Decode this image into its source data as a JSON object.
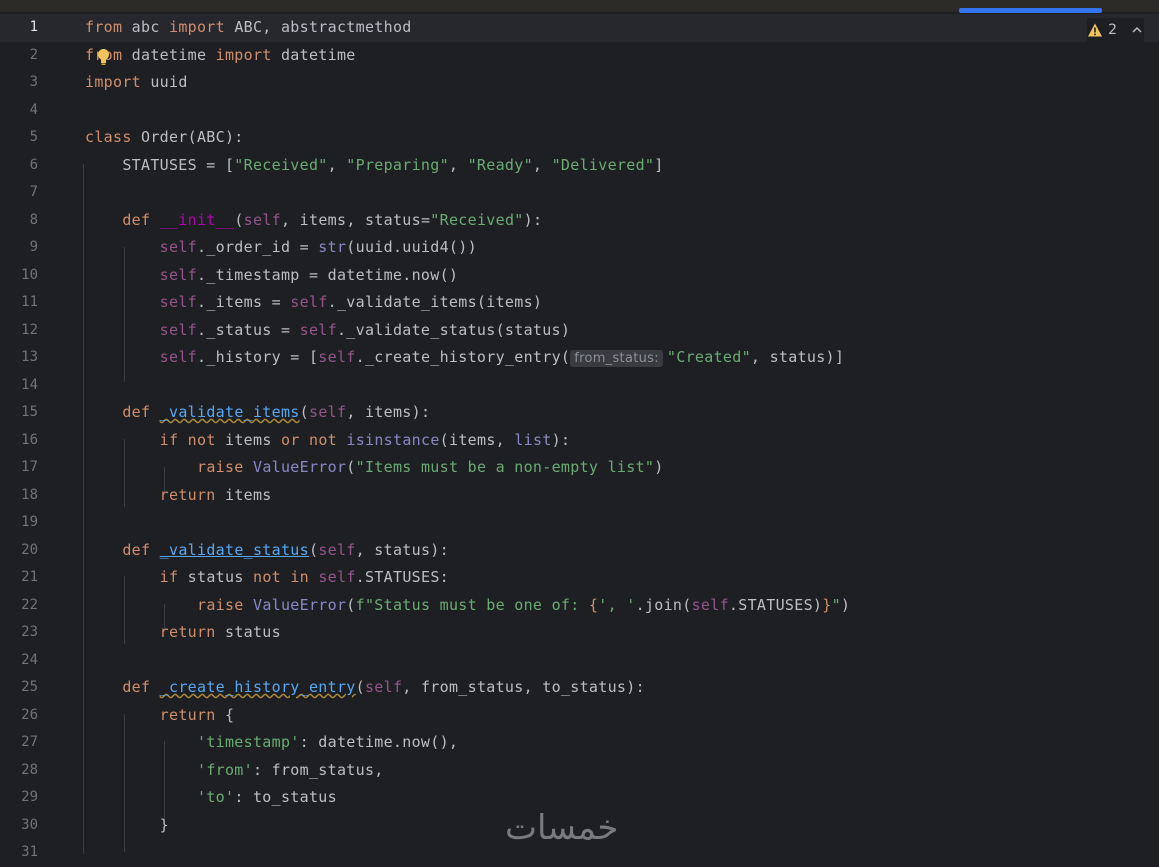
{
  "editor": {
    "warning_count": "2",
    "line_numbers": [
      "1",
      "2",
      "3",
      "4",
      "5",
      "6",
      "7",
      "8",
      "9",
      "10",
      "11",
      "12",
      "13",
      "14",
      "15",
      "16",
      "17",
      "18",
      "19",
      "20",
      "21",
      "22",
      "23",
      "24",
      "25",
      "26",
      "27",
      "28",
      "29",
      "30",
      "31"
    ],
    "inlay_hint": "from_status:",
    "watermark_text": "خمسات"
  },
  "code": {
    "l1": [
      "from",
      " abc ",
      "import",
      " ABC, abstractmethod"
    ],
    "l2": [
      "from",
      " datetime ",
      "import",
      " datetime"
    ],
    "l3": [
      "import",
      " uuid"
    ],
    "l5": [
      "class",
      " Order(ABC):"
    ],
    "l6": [
      "    STATUSES = [",
      "\"Received\"",
      ", ",
      "\"Preparing\"",
      ", ",
      "\"Ready\"",
      ", ",
      "\"Delivered\"",
      "]"
    ],
    "l8": [
      "    ",
      "def",
      " ",
      "__init__",
      "(",
      "self",
      ", items, status=",
      "\"Received\"",
      "):"
    ],
    "l9": [
      "        ",
      "self",
      "._order_id = ",
      "str",
      "(uuid.uuid4())"
    ],
    "l10": [
      "        ",
      "self",
      "._timestamp = datetime.now()"
    ],
    "l11": [
      "        ",
      "self",
      "._items = ",
      "self",
      "._validate_items(items)"
    ],
    "l12": [
      "        ",
      "self",
      "._status = ",
      "self",
      "._validate_status(status)"
    ],
    "l13": [
      "        ",
      "self",
      "._history = [",
      "self",
      "._create_history_entry(",
      "\"Created\"",
      ", status)]"
    ],
    "l15": [
      "    ",
      "def",
      " ",
      "_validate_items",
      "(",
      "self",
      ", items):"
    ],
    "l16": [
      "        ",
      "if",
      " ",
      "not",
      " items ",
      "or",
      " ",
      "not",
      " ",
      "isinstance",
      "(items, ",
      "list",
      "):"
    ],
    "l17": [
      "            ",
      "raise",
      " ",
      "ValueError",
      "(",
      "\"Items must be a non-empty list\"",
      ")"
    ],
    "l18": [
      "        ",
      "return",
      " items"
    ],
    "l20": [
      "    ",
      "def",
      " ",
      "_validate_status",
      "(",
      "self",
      ", status):"
    ],
    "l21": [
      "        ",
      "if",
      " status ",
      "not",
      " ",
      "in",
      " ",
      "self",
      ".STATUSES:"
    ],
    "l22": [
      "            ",
      "raise",
      " ",
      "ValueError",
      "(",
      "f\"Status must be one of: ",
      "{",
      "', '",
      ".join(",
      "self",
      ".STATUSES)",
      "}",
      "\"",
      ")"
    ],
    "l23": [
      "        ",
      "return",
      " status"
    ],
    "l25": [
      "    ",
      "def",
      " ",
      "_create_history_entry",
      "(",
      "self",
      ", from_status, to_status):"
    ],
    "l26": [
      "        ",
      "return",
      " {"
    ],
    "l27": [
      "            ",
      "'timestamp'",
      ": datetime.now(),"
    ],
    "l28": [
      "            ",
      "'from'",
      ": from_status,"
    ],
    "l29": [
      "            ",
      "'to'",
      ": to_status"
    ],
    "l30": [
      "        }"
    ]
  },
  "colors": {
    "background": "#1e1f22",
    "keyword": "#cf8e6d",
    "string": "#6aab73",
    "self": "#94558d",
    "function": "#56a8f5",
    "text": "#bcbec4",
    "accent": "#3574f0"
  },
  "icons": [
    "warning-icon",
    "chevron-up-icon",
    "lightbulb-icon"
  ]
}
